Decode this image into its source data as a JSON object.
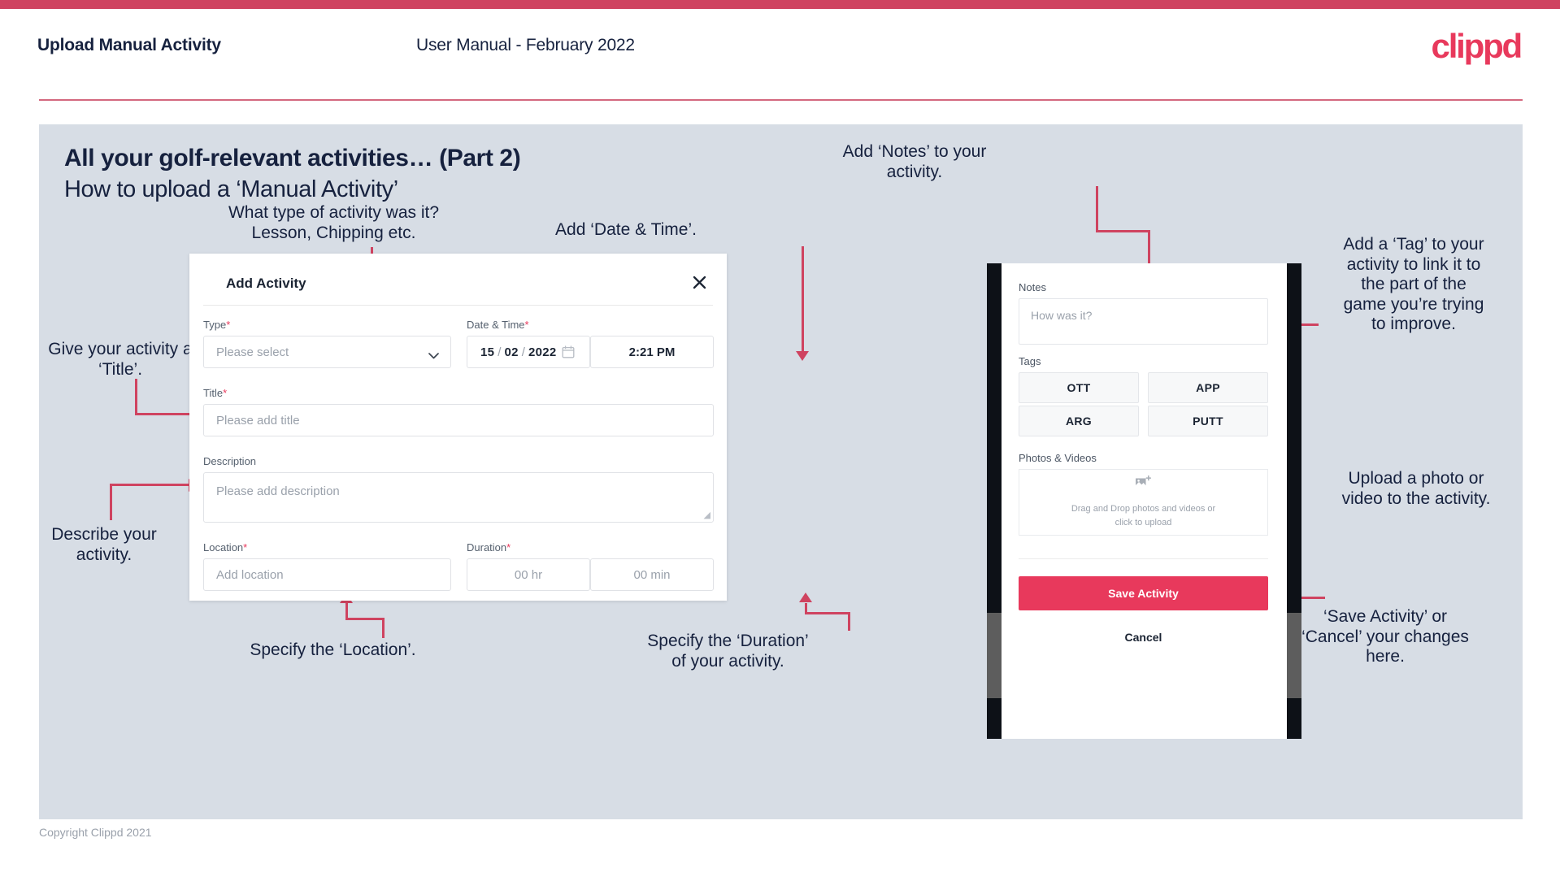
{
  "header": {
    "title": "Upload Manual Activity",
    "subtitle": "User Manual - February 2022",
    "logo": "clippd"
  },
  "slide": {
    "title": "All your golf-relevant activities… (Part 2)",
    "subtitle": "How to upload a ‘Manual Activity’"
  },
  "annotations": {
    "type": "What type of activity was it?\nLesson, Chipping etc.",
    "date_time": "Add ‘Date & Time’.",
    "notes": "Add ‘Notes’ to your\nactivity.",
    "tag": "Add a ‘Tag’ to your\nactivity to link it to\nthe part of the\ngame you’re trying\nto improve.",
    "title_field": "Give your activity a\n‘Title’.",
    "description": "Describe your\nactivity.",
    "location": "Specify the ‘Location’.",
    "duration": "Specify the ‘Duration’\nof your activity.",
    "upload": "Upload a photo or\nvideo to the activity.",
    "save_cancel": "‘Save Activity’ or\n‘Cancel’ your changes\nhere."
  },
  "dialog": {
    "title": "Add Activity",
    "close_icon": "close-icon",
    "fields": {
      "type": {
        "label": "Type",
        "required": "*",
        "placeholder": "Please select"
      },
      "date_time": {
        "label": "Date & Time",
        "required": "*",
        "day": "15",
        "month": "02",
        "year": "2022",
        "sep": "/",
        "time": "2:21 PM"
      },
      "title": {
        "label": "Title",
        "required": "*",
        "placeholder": "Please add title"
      },
      "description": {
        "label": "Description",
        "required": "",
        "placeholder": "Please add description"
      },
      "location": {
        "label": "Location",
        "required": "*",
        "placeholder": "Add location"
      },
      "duration": {
        "label": "Duration",
        "required": "*",
        "hours": "00 hr",
        "minutes": "00 min"
      }
    }
  },
  "phone": {
    "notes": {
      "label": "Notes",
      "placeholder": "How was it?"
    },
    "tags": {
      "label": "Tags",
      "items": [
        "OTT",
        "APP",
        "ARG",
        "PUTT"
      ]
    },
    "photos": {
      "label": "Photos & Videos",
      "dropzone_line1": "Drag and Drop photos and videos or",
      "dropzone_line2": "click to upload",
      "icon": "add-image-icon"
    },
    "save_label": "Save Activity",
    "cancel_label": "Cancel"
  },
  "footer": {
    "copyright": "Copyright Clippd 2021"
  },
  "colors": {
    "accent": "#e8395c",
    "connector": "#cf4360",
    "slide_bg": "#d7dde5",
    "text_dark": "#16213e"
  }
}
